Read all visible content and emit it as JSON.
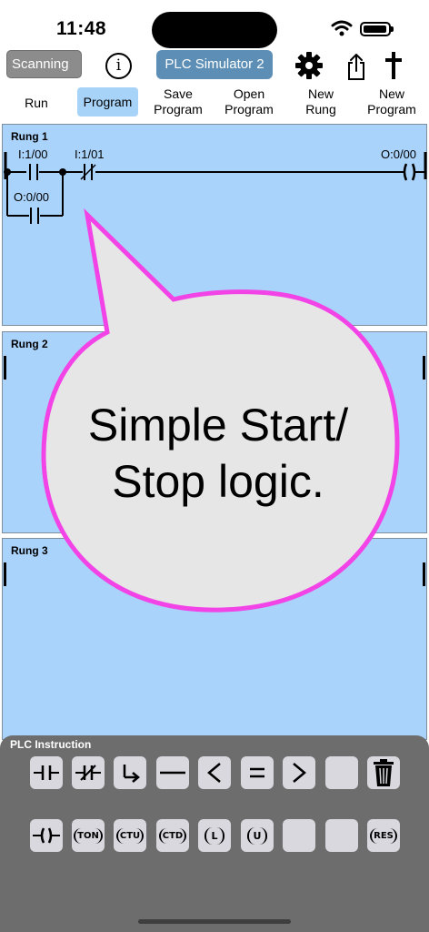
{
  "status_bar": {
    "time": "11:48"
  },
  "toolbar": {
    "scanning_label": "Scanning",
    "info_label": "i",
    "title": "PLC Simulator 2",
    "run_label": "Run",
    "program_label": "Program",
    "save_label": [
      "Save",
      "Program"
    ],
    "open_label": [
      "Open",
      "Program"
    ],
    "new_rung_label": [
      "New",
      "Rung"
    ],
    "new_program_label": [
      "New",
      "Program"
    ]
  },
  "rungs": [
    {
      "label": "Rung 1",
      "contacts": [
        {
          "tag": "I:1/00",
          "type": "normally-open"
        },
        {
          "tag": "I:1/01",
          "type": "normally-closed"
        }
      ],
      "branch": {
        "tag": "O:0/00",
        "type": "normally-open"
      },
      "coil": {
        "tag": "O:0/00",
        "type": "output-energize"
      }
    },
    {
      "label": "Rung 2"
    },
    {
      "label": "Rung 3"
    }
  ],
  "callout": {
    "line1": "Simple Start/",
    "line2": "Stop logic."
  },
  "palette": {
    "title": "PLC Instruction",
    "row1": [
      "xic-icon",
      "xio-icon",
      "branch-icon",
      "wire-icon",
      "less-than-icon",
      "equal-icon",
      "greater-than-icon",
      "empty-slot",
      "trash-icon"
    ],
    "row2_labels": {
      "ton": "TON",
      "ctu": "CTU",
      "ctd": "CTD",
      "latch": "L",
      "unlatch": "U",
      "res": "RES"
    }
  },
  "colors": {
    "rung_bg": "#a9d3fb",
    "selected_tab": "#a8d3f8",
    "title_badge": "#5d8fb6",
    "callout_border": "#f244e6",
    "callout_fill": "#e6e6e6",
    "palette_bg": "#6d6d6d"
  }
}
